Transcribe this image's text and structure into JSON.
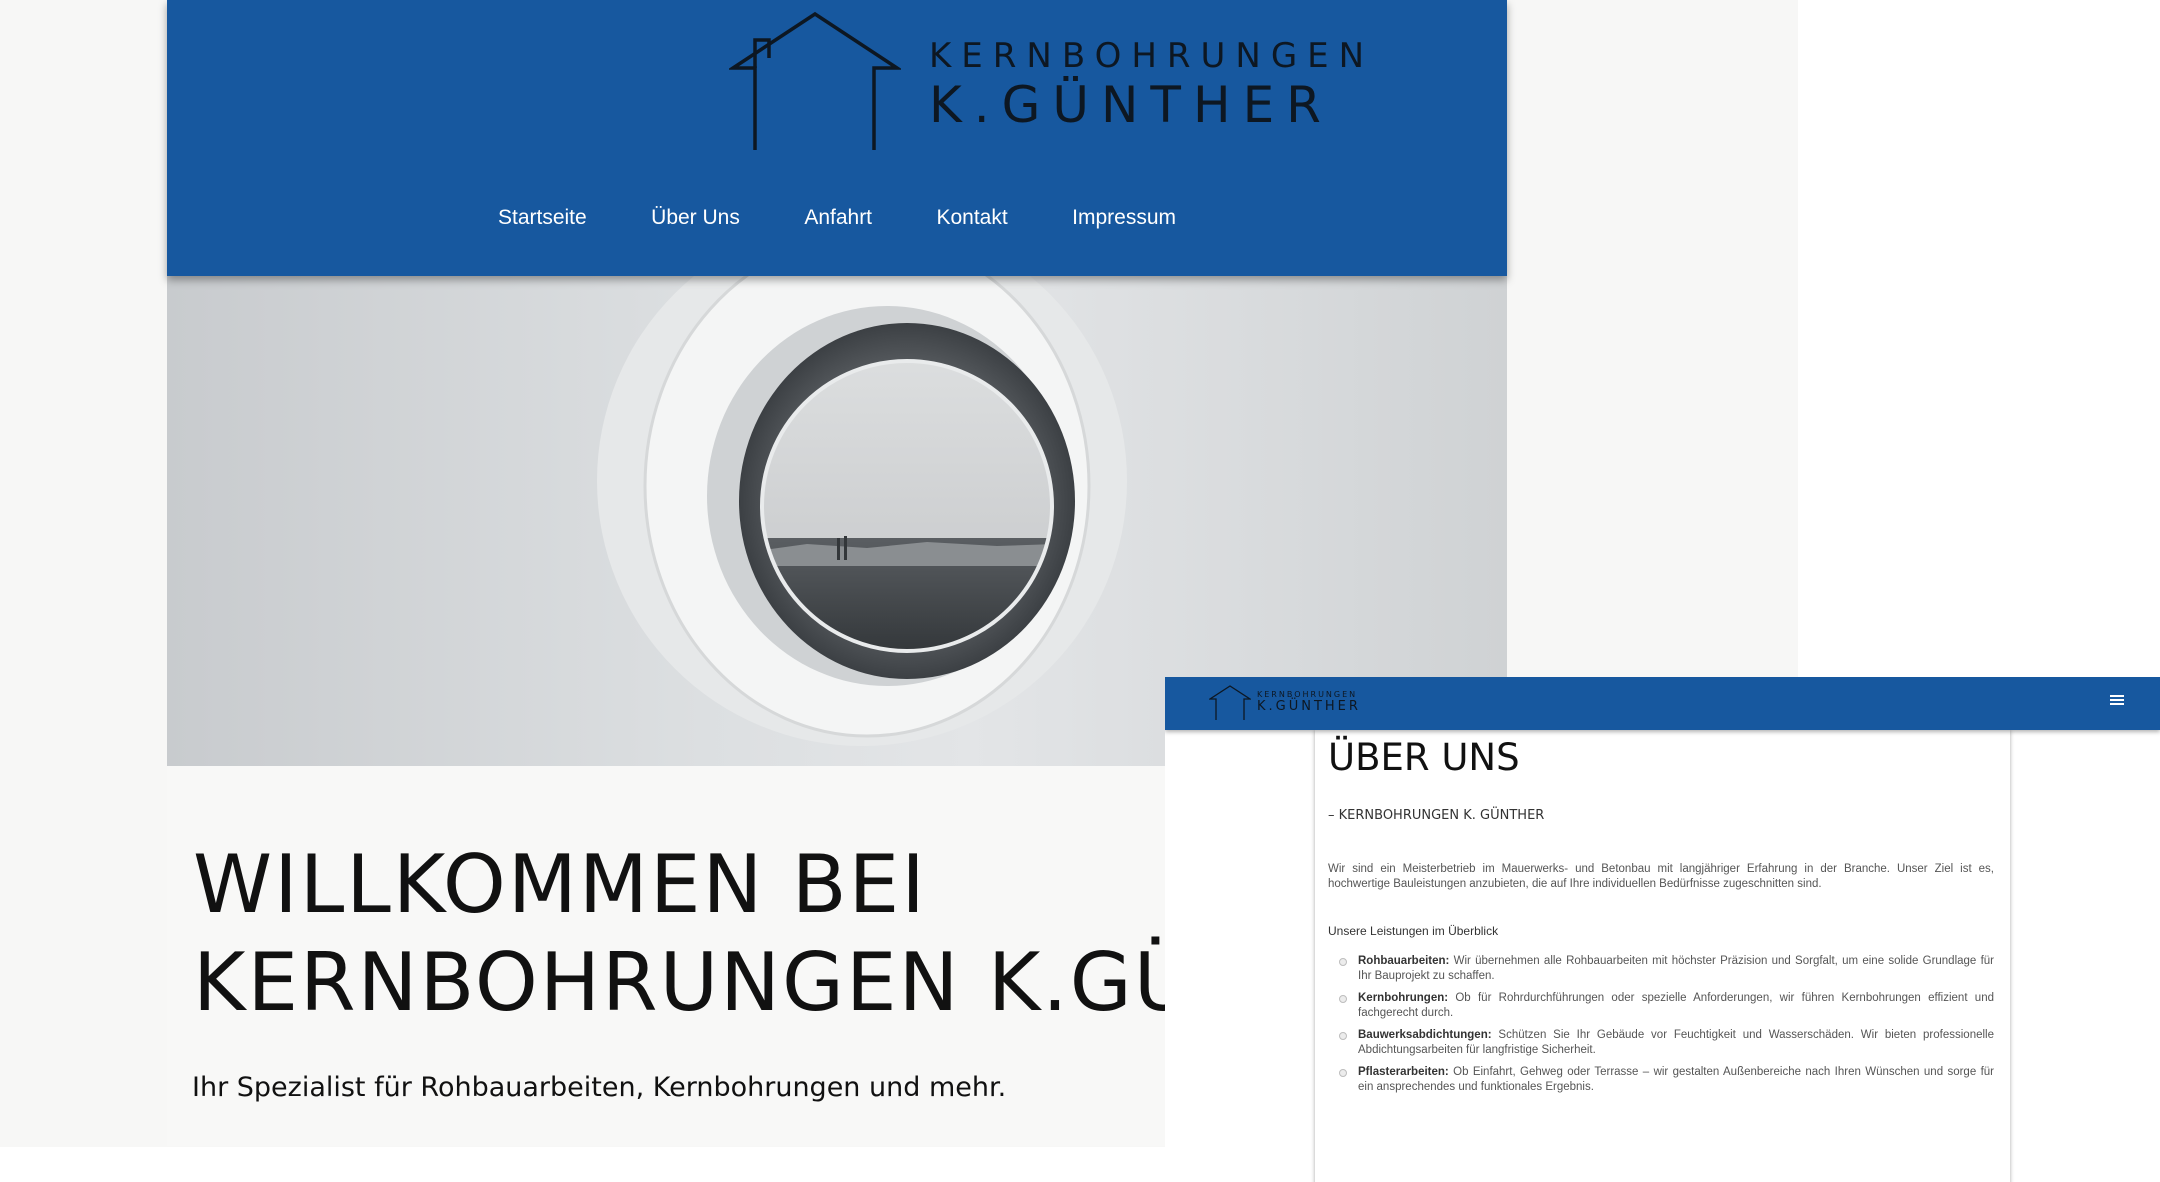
{
  "desktop": {
    "logo": {
      "line1": "KERNBOHRUNGEN",
      "line2": "K.GÜNTHER"
    },
    "nav": [
      "Startseite",
      "Über Uns",
      "Anfahrt",
      "Kontakt",
      "Impressum"
    ],
    "welcome_line1": "WILLKOMMEN BEI",
    "welcome_line2": "KERNBOHRUNGEN K.GÜN",
    "subtitle": "Ihr Spezialist für Rohbauarbeiten, Kernbohrungen und mehr."
  },
  "mobile": {
    "logo": {
      "line1": "KERNBOHRUNGEN",
      "line2": "K.GÜNTHER"
    },
    "menu_icon": "hamburger-icon",
    "title": "ÜBER UNS",
    "kicker": "– KERNBOHRUNGEN K. GÜNTHER",
    "intro": "Wir sind ein Meisterbetrieb im Mauerwerks- und Betonbau mit langjähriger Erfahrung in der Branche. Unser Ziel ist es, hochwertige Bauleistungen anzubieten, die auf Ihre individuellen Bedürfnisse zugeschnitten sind.",
    "services_title": "Unsere Leistungen im Überblick",
    "services": [
      {
        "name": "Rohbauarbeiten:",
        "text": " Wir übernehmen alle Rohbauarbeiten mit höchster Präzision und Sorgfalt, um eine solide Grundlage für Ihr Bauprojekt zu schaffen."
      },
      {
        "name": "Kernbohrungen:",
        "text": " Ob für Rohrdurchführungen oder spezielle Anforderungen, wir führen Kernbohrungen effizient und fachgerecht durch."
      },
      {
        "name": "Bauwerksabdichtungen:",
        "text": " Schützen Sie Ihr Gebäude vor Feuchtigkeit und Wasserschäden. Wir bieten professionelle Abdichtungsarbeiten für langfristige Sicherheit."
      },
      {
        "name": "Pflasterarbeiten:",
        "text": " Ob Einfahrt, Gehweg oder Terrasse – wir gestalten Außenbereiche nach Ihren Wünschen und sorge für ein ansprechendes und funktionales Ergebnis."
      }
    ]
  },
  "colors": {
    "header_blue": "#17589f",
    "logo_dark": "#0d1722"
  }
}
